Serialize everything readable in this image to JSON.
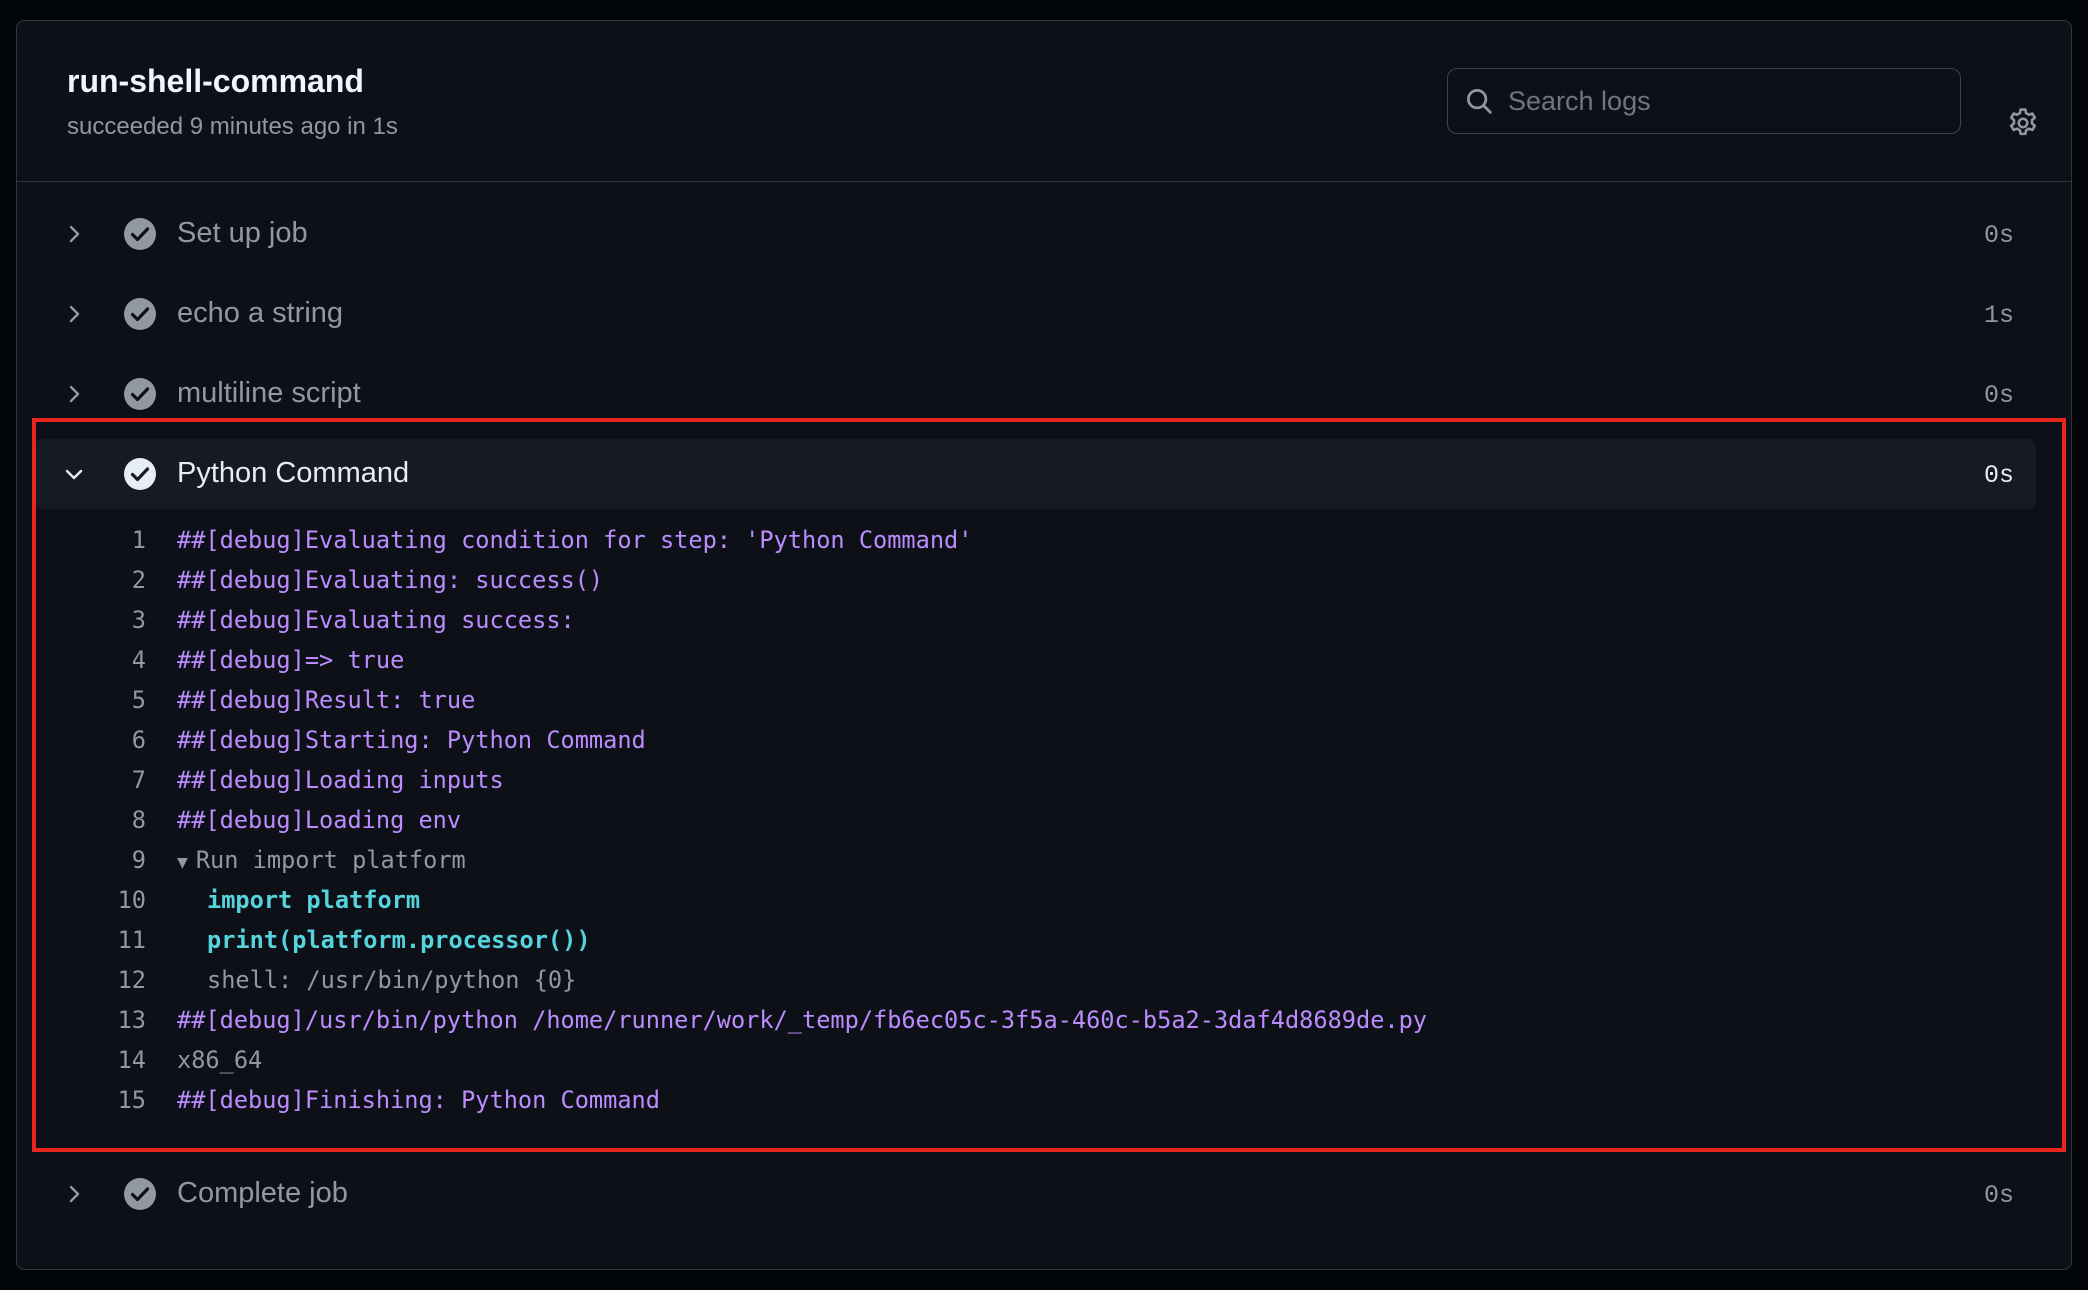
{
  "job": {
    "title": "run-shell-command",
    "subtitle": "succeeded 9 minutes ago in 1s"
  },
  "search": {
    "placeholder": "Search logs",
    "value": ""
  },
  "icons": {
    "search": "search-icon",
    "settings": "gear-icon",
    "collapsed": "chevron-right-icon",
    "expanded": "chevron-down-icon",
    "status": "check-circle-icon"
  },
  "colors": {
    "background": "#0d1117",
    "debug_text": "#bc8cff",
    "command_text": "#56d4dd",
    "highlight_border": "#e8261b",
    "success_icon": "#9198a1"
  },
  "steps": [
    {
      "name": "Set up job",
      "duration": "0s",
      "expanded": false
    },
    {
      "name": "echo a string",
      "duration": "1s",
      "expanded": false
    },
    {
      "name": "multiline script",
      "duration": "0s",
      "expanded": false
    },
    {
      "name": "Python Command",
      "duration": "0s",
      "expanded": true
    },
    {
      "name": "Complete job",
      "duration": "0s",
      "expanded": false
    }
  ],
  "log": [
    {
      "num": "1",
      "text": "##[debug]Evaluating condition for step: 'Python Command'",
      "kind": "debug"
    },
    {
      "num": "2",
      "text": "##[debug]Evaluating: success()",
      "kind": "debug"
    },
    {
      "num": "3",
      "text": "##[debug]Evaluating success:",
      "kind": "debug"
    },
    {
      "num": "4",
      "text": "##[debug]=> true",
      "kind": "debug"
    },
    {
      "num": "5",
      "text": "##[debug]Result: true",
      "kind": "debug"
    },
    {
      "num": "6",
      "text": "##[debug]Starting: Python Command",
      "kind": "debug"
    },
    {
      "num": "7",
      "text": "##[debug]Loading inputs",
      "kind": "debug"
    },
    {
      "num": "8",
      "text": "##[debug]Loading env",
      "kind": "debug"
    },
    {
      "num": "9",
      "text": "Run import platform",
      "kind": "group"
    },
    {
      "num": "10",
      "text": "import platform",
      "kind": "cmd"
    },
    {
      "num": "11",
      "text": "print(platform.processor())",
      "kind": "cmd"
    },
    {
      "num": "12",
      "text": "shell: /usr/bin/python {0}",
      "kind": "meta"
    },
    {
      "num": "13",
      "text": "##[debug]/usr/bin/python /home/runner/work/_temp/fb6ec05c-3f5a-460c-b5a2-3daf4d8689de.py",
      "kind": "debug"
    },
    {
      "num": "14",
      "text": "x86_64",
      "kind": "plain"
    },
    {
      "num": "15",
      "text": "##[debug]Finishing: Python Command",
      "kind": "debug"
    }
  ]
}
